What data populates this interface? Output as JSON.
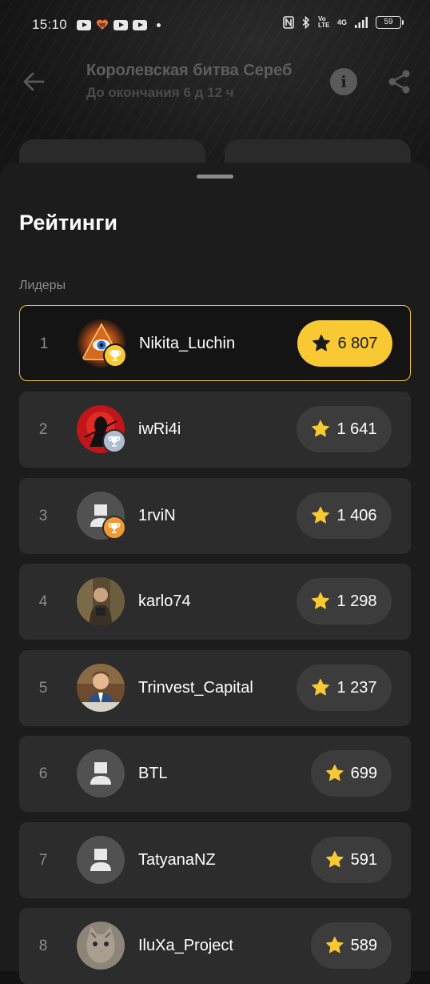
{
  "status_bar": {
    "time": "15:10",
    "battery": "59",
    "network": "4G",
    "volte": "Vo LTE"
  },
  "header": {
    "title": "Королевская битва Сереб",
    "subtitle": "До окончания 6 д 12 ч"
  },
  "sheet": {
    "title": "Рейтинги",
    "section_label": "Лидеры"
  },
  "colors": {
    "accent": "#f8c932",
    "row_bg": "#2c2c2c",
    "sheet_bg": "#1c1c1c",
    "trophy_gold": "#f8c932",
    "trophy_silver": "#aebdd0",
    "trophy_bronze": "#f19a33"
  },
  "leaders": [
    {
      "rank": "1",
      "name": "Nikita_Luchin",
      "score": "6 807",
      "avatar": "eye-pyramid-avatar",
      "trophy": "gold"
    },
    {
      "rank": "2",
      "name": "iwRi4i",
      "score": "1 641",
      "avatar": "red-samurai-avatar",
      "trophy": "silver"
    },
    {
      "rank": "3",
      "name": "1rviN",
      "score": "1 406",
      "avatar": "default-user-avatar",
      "trophy": "bronze"
    },
    {
      "rank": "4",
      "name": "karlo74",
      "score": "1 298",
      "avatar": "photo-avatar",
      "trophy": "none"
    },
    {
      "rank": "5",
      "name": "Trinvest_Capital",
      "score": "1 237",
      "avatar": "businessman-avatar",
      "trophy": "none"
    },
    {
      "rank": "6",
      "name": "BTL",
      "score": "699",
      "avatar": "default-user-avatar",
      "trophy": "none"
    },
    {
      "rank": "7",
      "name": "TatyanaNZ",
      "score": "591",
      "avatar": "default-user-avatar",
      "trophy": "none"
    },
    {
      "rank": "8",
      "name": "IluXa_Project",
      "score": "589",
      "avatar": "cat-avatar",
      "trophy": "none"
    }
  ]
}
